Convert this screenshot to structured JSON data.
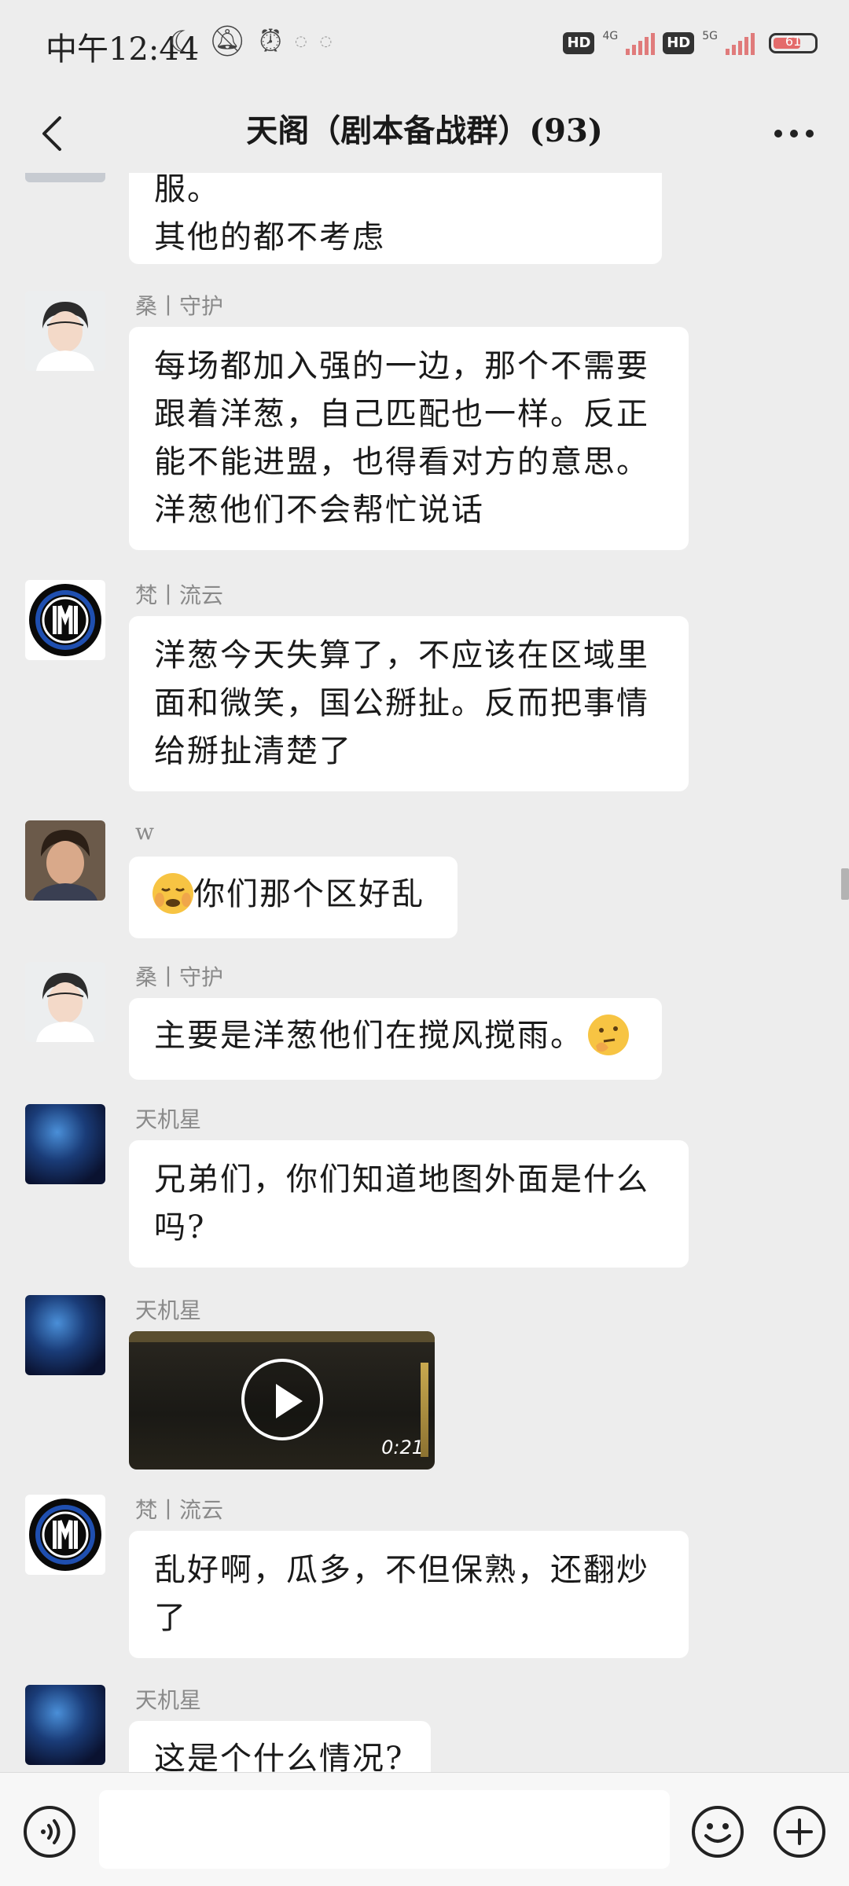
{
  "status_bar": {
    "time": "中午12:44",
    "net1": "4G",
    "net2": "5G",
    "hd_label": "HD",
    "battery_level": "61",
    "icons": [
      "moon-icon",
      "bell-off-icon",
      "alarm-icon"
    ]
  },
  "header": {
    "title": "天阁（剧本备战群）(93)"
  },
  "messages": [
    {
      "sender": "",
      "avatar": "avatar-partial",
      "text_lines": [
        "洋葱他们就是指总的怎么混征服。",
        "其他的都不考虑"
      ]
    },
    {
      "sender": "桑丨守护",
      "avatar": "avatar-person-1",
      "text_lines": [
        "每场都加入强的一边，那个不需要",
        "跟着洋葱，自己匹配也一样。反正",
        "能不能进盟，也得看对方的意思。",
        "洋葱他们不会帮忙说话"
      ]
    },
    {
      "sender": "梵丨流云",
      "avatar": "avatar-inter-logo",
      "text_lines": [
        "洋葱今天失算了，不应该在区域里",
        "面和微笑，国公掰扯。反而把事情",
        "给掰扯清楚了"
      ]
    },
    {
      "sender": "w",
      "avatar": "avatar-kid",
      "text_lines": [
        "你们那个区好乱"
      ],
      "emoji": "crying-face-emoji"
    },
    {
      "sender": "桑丨守护",
      "avatar": "avatar-person-1",
      "text_lines": [
        "主要是洋葱他们在搅风搅雨。"
      ],
      "emoji": "thinking-face-emoji"
    },
    {
      "sender": "天机星",
      "avatar": "avatar-stars",
      "text_lines": [
        "兄弟们，你们知道地图外面是什么",
        "吗?"
      ]
    },
    {
      "sender": "天机星",
      "avatar": "avatar-stars",
      "video": {
        "duration": "0:21"
      }
    },
    {
      "sender": "梵丨流云",
      "avatar": "avatar-inter-logo",
      "text_lines": [
        "乱好啊，瓜多，不但保熟，还翻炒",
        "了"
      ]
    },
    {
      "sender": "天机星",
      "avatar": "avatar-stars",
      "text_lines": [
        "这是个什么情况?"
      ]
    }
  ],
  "input_bar": {
    "placeholder": "",
    "icons": [
      "voice-icon",
      "emoji-icon",
      "plus-icon"
    ]
  },
  "colors": {
    "background": "#ededed",
    "bubble": "#ffffff",
    "sender_text": "#8a8a8a"
  }
}
